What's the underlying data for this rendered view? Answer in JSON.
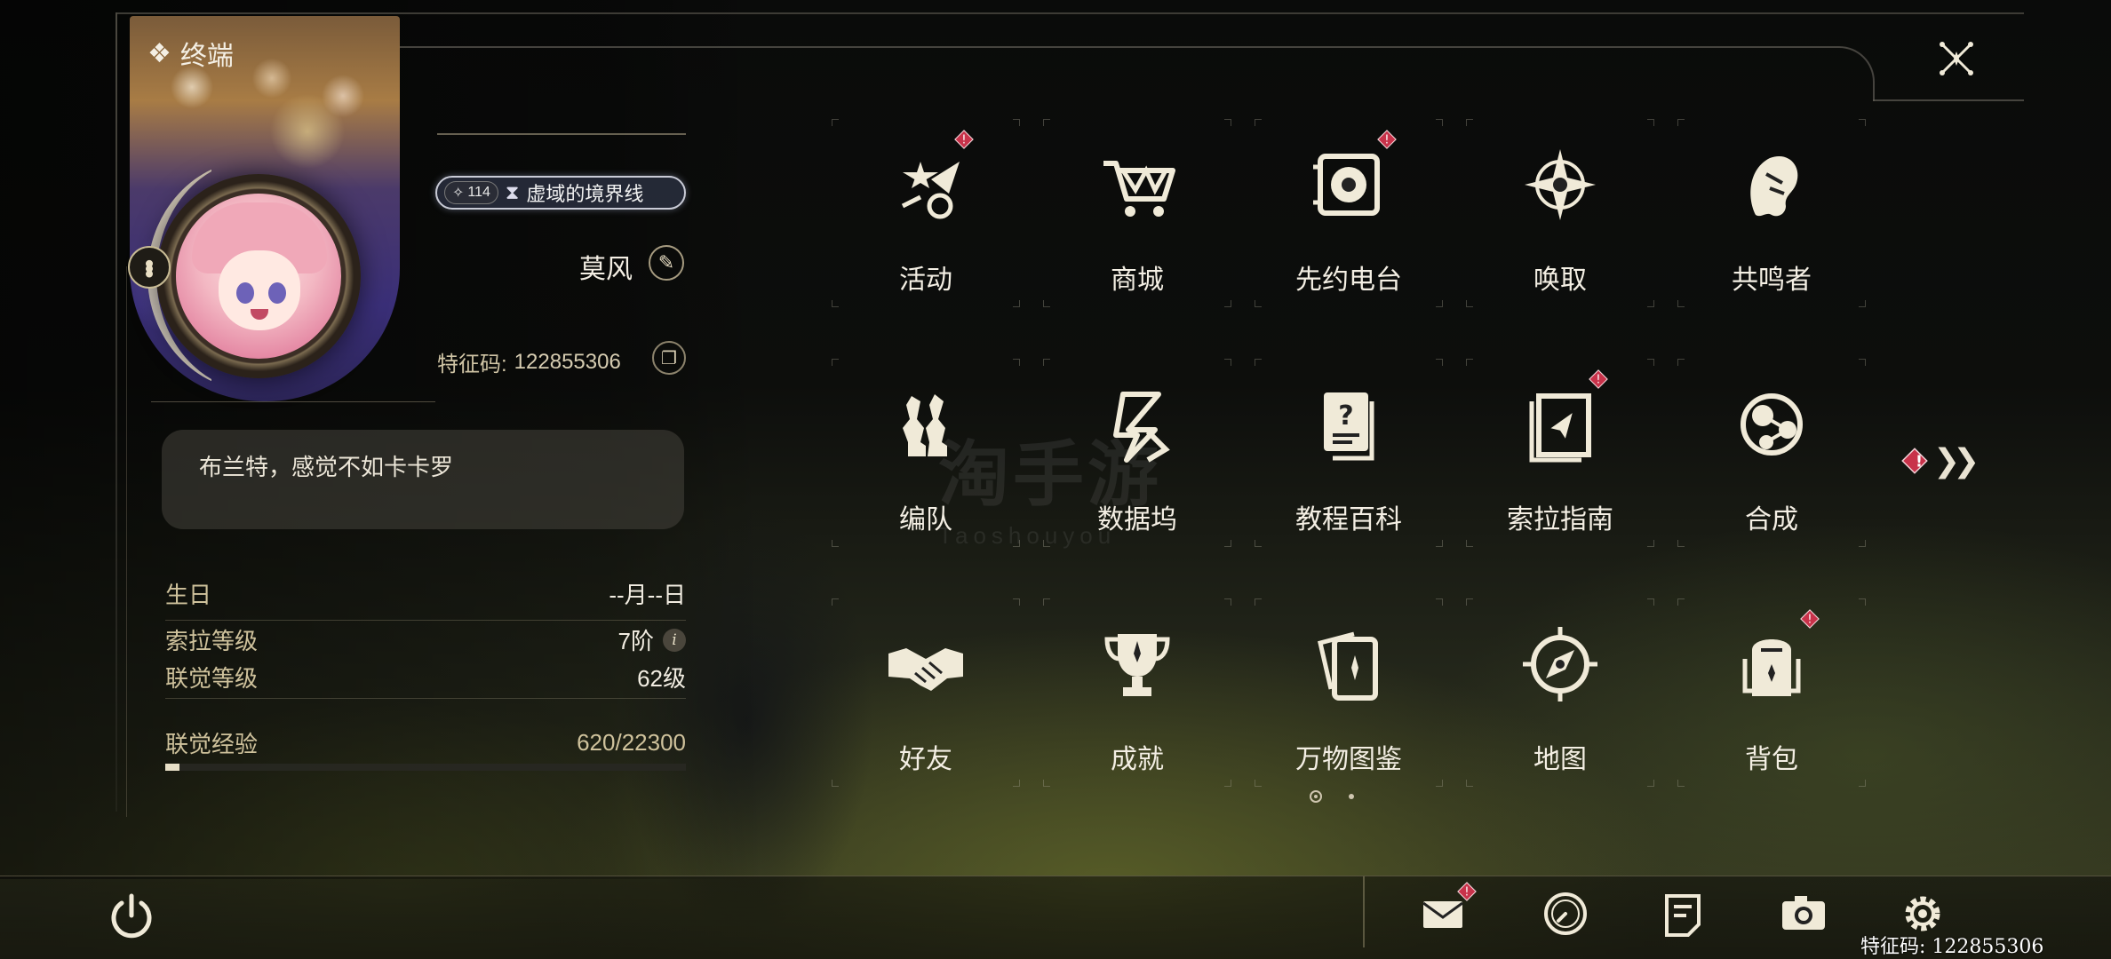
{
  "panel": {
    "title": "终端",
    "rank_level": "114",
    "rank_name": "虚域的境界线",
    "nickname": "莫风",
    "uid_label": "特征码:",
    "uid_value": "122855306",
    "signature": "布兰特，感觉不如卡卡罗"
  },
  "stats": {
    "birthday_label": "生日",
    "birthday_value": "--月--日",
    "sola_label": "索拉等级",
    "sola_value": "7阶",
    "union_label": "联觉等级",
    "union_value": "62级",
    "exp_label": "联觉经验",
    "exp_value": "620/22300",
    "exp_progress": 0.028
  },
  "menu": {
    "items": [
      {
        "label": "活动",
        "icon": "events-icon",
        "badge": true
      },
      {
        "label": "商城",
        "icon": "shop-cart-icon",
        "badge": false
      },
      {
        "label": "先约电台",
        "icon": "radio-icon",
        "badge": true
      },
      {
        "label": "唤取",
        "icon": "convene-star-icon",
        "badge": false
      },
      {
        "label": "共鸣者",
        "icon": "resonator-icon",
        "badge": false
      },
      {
        "label": "编队",
        "icon": "team-icon",
        "badge": false
      },
      {
        "label": "数据坞",
        "icon": "data-bank-icon",
        "badge": false
      },
      {
        "label": "教程百科",
        "icon": "tutorial-icon",
        "badge": false
      },
      {
        "label": "索拉指南",
        "icon": "guidebook-icon",
        "badge": true
      },
      {
        "label": "合成",
        "icon": "synthesis-icon",
        "badge": false
      },
      {
        "label": "好友",
        "icon": "friends-handshake-icon",
        "badge": false
      },
      {
        "label": "成就",
        "icon": "achievement-trophy-icon",
        "badge": false
      },
      {
        "label": "万物图鉴",
        "icon": "archive-cards-icon",
        "badge": false
      },
      {
        "label": "地图",
        "icon": "map-compass-icon",
        "badge": false
      },
      {
        "label": "背包",
        "icon": "backpack-icon",
        "badge": true
      }
    ],
    "page_count": 2,
    "current_page": 1
  },
  "bottom_bar": {
    "icons": [
      "mail-icon",
      "clock-icon",
      "notice-icon",
      "camera-icon",
      "settings-gear-icon"
    ],
    "mail_badge": true
  },
  "footer": {
    "uid_text": "特征码: 122855306"
  },
  "watermark": {
    "main": "淘手游",
    "sub": "Taoshouyou"
  },
  "colors": {
    "accent": "#f0ead8",
    "badge": "#c8324a",
    "label_gold": "#cfc29c"
  }
}
